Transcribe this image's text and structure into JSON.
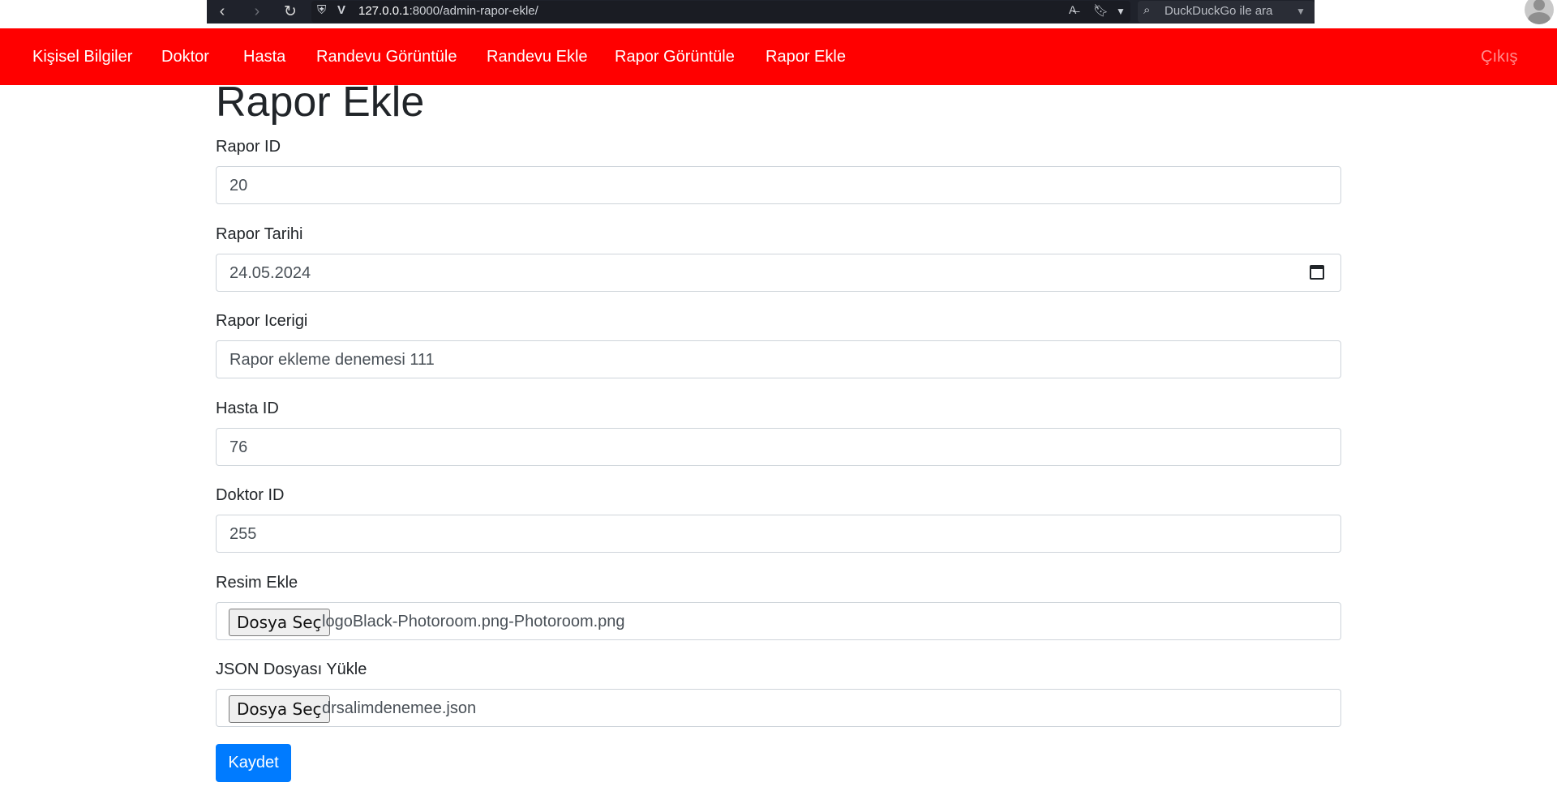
{
  "browser": {
    "url_host": "127.0.0.1",
    "url_rest": ":8000/admin-rapor-ekle/",
    "search_placeholder": "DuckDuckGo ile ara"
  },
  "navbar": {
    "items": [
      {
        "label": "Kişisel Bilgiler"
      },
      {
        "label": "Doktor"
      },
      {
        "label": "Hasta"
      },
      {
        "label": "Randevu Görüntüle"
      },
      {
        "label": "Randevu Ekle"
      },
      {
        "label": "Rapor Görüntüle"
      },
      {
        "label": "Rapor Ekle"
      }
    ],
    "logout": "Çıkış",
    "color": "#ff0000"
  },
  "form": {
    "title": "Rapor Ekle",
    "fields": [
      {
        "label": "Rapor ID",
        "value": "20"
      },
      {
        "label": "Rapor Tarihi",
        "value": "24.05.2024"
      },
      {
        "label": "Rapor Icerigi",
        "value": "Rapor ekleme denemesi 111"
      },
      {
        "label": "Hasta ID",
        "value": "76"
      },
      {
        "label": "Doktor ID",
        "value": "255"
      },
      {
        "label": "Resim Ekle",
        "button": "Dosya Seç",
        "file": "logoBlack-Photoroom.png-Photoroom.png"
      },
      {
        "label": "JSON Dosyası Yükle",
        "button": "Dosya Seç",
        "file": "drsalimdenemee.json"
      }
    ],
    "submit": "Kaydet",
    "accent": "#007bff"
  }
}
